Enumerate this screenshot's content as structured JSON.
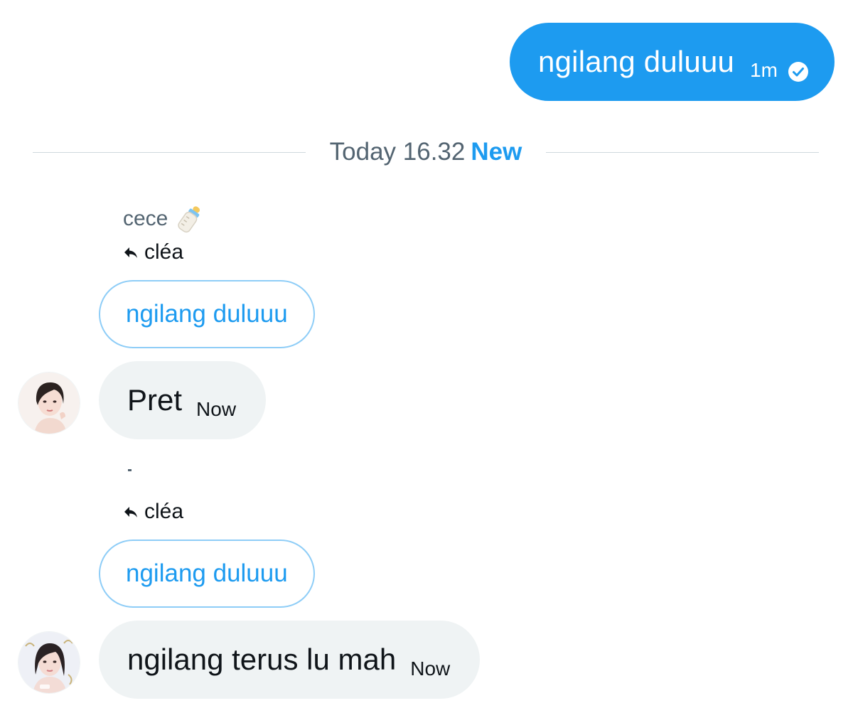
{
  "outgoing": {
    "text": "ngilang duluuu",
    "time": "1m",
    "status_icon": "check-circle-icon"
  },
  "divider": {
    "date": "Today 16.32",
    "new_label": "New"
  },
  "messages": [
    {
      "sender": "cece",
      "sender_emoji": "baby-bottle-icon",
      "reply_to": "cléa",
      "quoted": "ngilang duluuu",
      "text": "Pret",
      "time": "Now"
    },
    {
      "sender": "",
      "reply_to": "cléa",
      "quoted": "ngilang duluuu",
      "text": "ngilang terus lu mah",
      "time": "Now"
    }
  ],
  "colors": {
    "accent": "#1d9bf0",
    "incoming_bg": "#eff3f4",
    "muted_text": "#536471",
    "quoted_border": "#8ecdf7"
  }
}
